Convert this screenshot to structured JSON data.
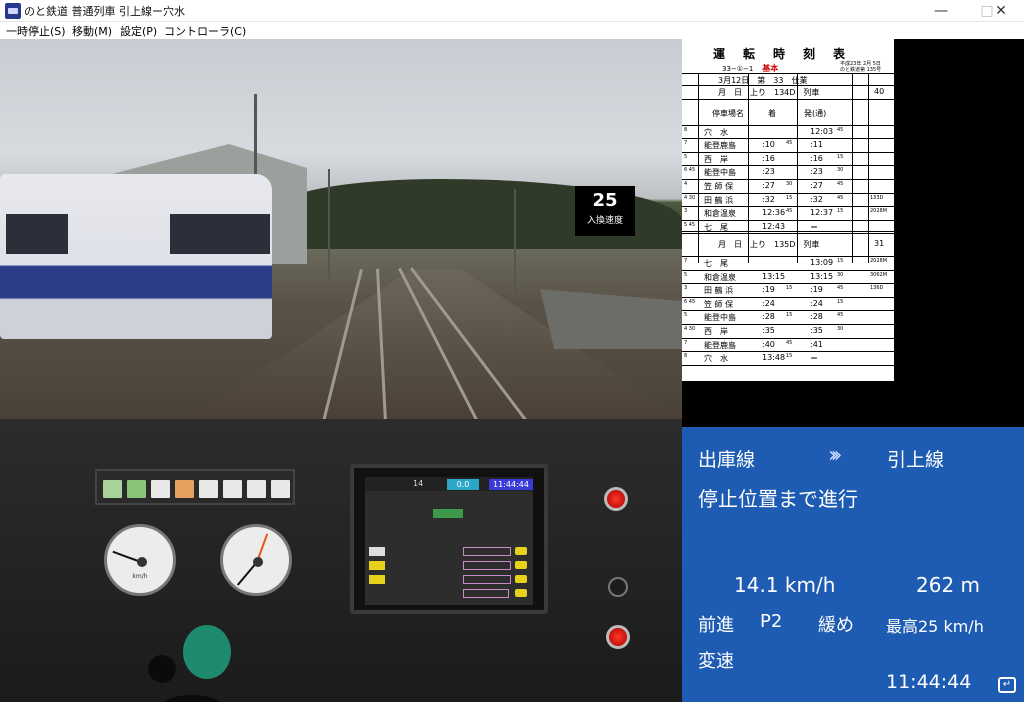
{
  "window": {
    "title": "のと鉄道 普通列車 引上線ー穴水",
    "min_icon": "minimize-icon",
    "max_icon": "maximize-icon",
    "close_icon": "close-icon"
  },
  "menu": [
    {
      "label": "一時停止(S)"
    },
    {
      "label": "移動(M)"
    },
    {
      "label": "設定(P)"
    },
    {
      "label": "コントローラ(C)"
    }
  ],
  "scene": {
    "limit_value": "25",
    "limit_label": "入換速度"
  },
  "timetable": {
    "title": "運転時刻表",
    "sub": "33−①−1",
    "kind": "基本",
    "date_note_1": "平成23年 2月 5日",
    "date_note_2": "のと鉄道第 135号",
    "block1": {
      "header": "3月12日　第　33　仕業",
      "header2": "月　日　上り　134D　列車",
      "col_station": "停車場名",
      "col_arr": "着",
      "col_dep": "発(通)",
      "col_max": "40",
      "rows": [
        {
          "min": "8",
          "station": "穴　水",
          "arr": "",
          "dep": "12:03",
          "dep_s": "45",
          "note": ""
        },
        {
          "min": "7",
          "station": "能登鹿島",
          "arr": ":10",
          "arr_s": "45",
          "dep": ":11",
          "dep_s": "",
          "note": ""
        },
        {
          "min": "5",
          "station": "西　岸",
          "arr": ":16",
          "arr_s": "",
          "dep": ":16",
          "dep_s": "15",
          "note": ""
        },
        {
          "min": "6 45",
          "station": "能登中島",
          "arr": ":23",
          "arr_s": "",
          "dep": ":23",
          "dep_s": "30",
          "note": ""
        },
        {
          "min": "4",
          "station": "笠 師 保",
          "arr": ":27",
          "arr_s": "30",
          "dep": ":27",
          "dep_s": "45",
          "note": ""
        },
        {
          "min": "4 30",
          "station": "田 鶴 浜",
          "arr": ":32",
          "arr_s": "15",
          "dep": ":32",
          "dep_s": "45",
          "note": "133D"
        },
        {
          "min": "3",
          "station": "和倉温泉",
          "arr": "12:36",
          "arr_s": "45",
          "dep": "12:37",
          "dep_s": "15",
          "note": "2028M"
        },
        {
          "min": "5 45",
          "station": "七　尾",
          "arr": "12:43",
          "arr_s": "",
          "dep": "＝",
          "dep_s": "",
          "note": ""
        }
      ]
    },
    "block2": {
      "header": "月　日　上り　135D　列車",
      "col_max": "31",
      "rows": [
        {
          "min": "7",
          "station": "七　尾",
          "arr": "",
          "dep": "13:09",
          "dep_s": "15",
          "note": "2028M"
        },
        {
          "min": "5",
          "station": "和倉温泉",
          "arr": "13:15",
          "arr_s": "",
          "dep": "13:15",
          "dep_s": "30",
          "note": "3062M"
        },
        {
          "min": "3",
          "station": "田 鶴 浜",
          "arr": ":19",
          "arr_s": "15",
          "dep": ":19",
          "dep_s": "45",
          "note": "136D"
        },
        {
          "min": "6 45",
          "station": "笠 師 保",
          "arr": ":24",
          "arr_s": "",
          "dep": ":24",
          "dep_s": "15",
          "note": ""
        },
        {
          "min": "5",
          "station": "能登中島",
          "arr": ":28",
          "arr_s": "15",
          "dep": ":28",
          "dep_s": "45",
          "note": ""
        },
        {
          "min": "4 30",
          "station": "西　岸",
          "arr": ":35",
          "arr_s": "",
          "dep": ":35",
          "dep_s": "30",
          "note": ""
        },
        {
          "min": "7",
          "station": "能登鹿島",
          "arr": ":40",
          "arr_s": "45",
          "dep": ":41",
          "dep_s": "",
          "note": ""
        },
        {
          "min": "8",
          "station": "穴　水",
          "arr": "13:48",
          "arr_s": "15",
          "dep": "＝",
          "dep_s": "",
          "note": ""
        }
      ]
    }
  },
  "monitor": {
    "notch": "14",
    "speed": "0.0",
    "time": "11:44:44"
  },
  "info": {
    "from": "出庫線",
    "arrows": "›››",
    "to": "引上線",
    "message": "停止位置まで進行",
    "speed": "14.1 km/h",
    "distance": "262 m",
    "direction": "前進",
    "notch": "P2",
    "brake": "緩め",
    "max_speed": "最高25 km/h",
    "mode": "変速",
    "time": "11:44:44",
    "enter_icon": "enter-icon"
  }
}
